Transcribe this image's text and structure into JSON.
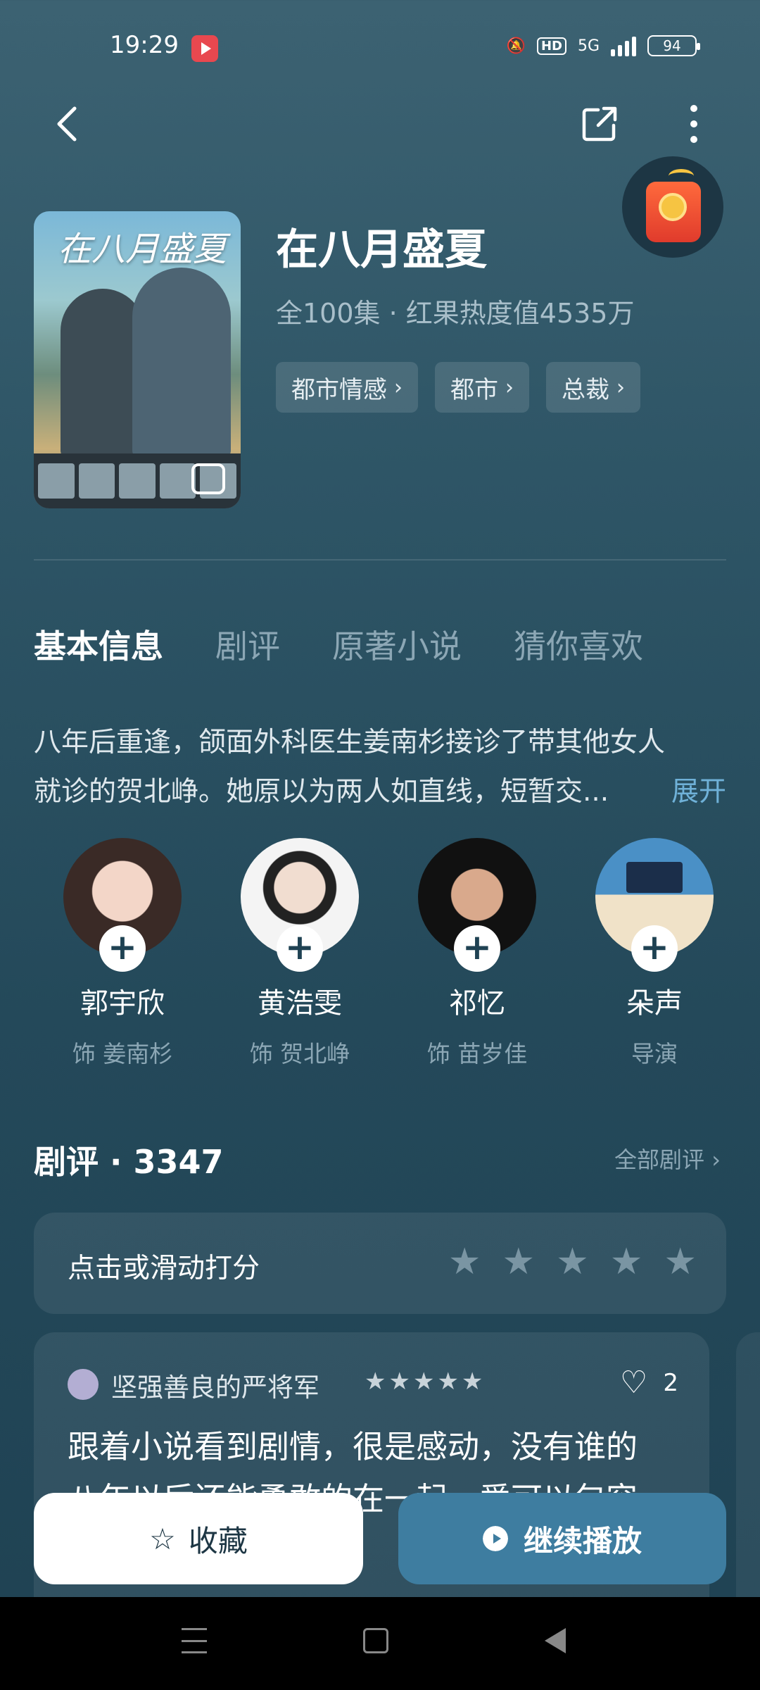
{
  "status_bar": {
    "time": "19:29",
    "network": "5G",
    "hd": "HD",
    "battery": "94"
  },
  "drama": {
    "title": "在八月盛夏",
    "poster_title": "在八月盛夏",
    "meta": "全100集 · 红果热度值4535万",
    "tags": [
      "都市情感",
      "都市",
      "总裁"
    ]
  },
  "tabs": [
    "基本信息",
    "剧评",
    "原著小说",
    "猜你喜欢"
  ],
  "synopsis": {
    "line1": "八年后重逢，颌面外科医生姜南杉接诊了带其他女人",
    "line2": "就诊的贺北峥。她原以为两人如直线，短暂交...",
    "expand": "展开"
  },
  "cast": [
    {
      "name": "郭宇欣",
      "role": "饰 姜南杉"
    },
    {
      "name": "黄浩雯",
      "role": "饰 贺北峥"
    },
    {
      "name": "祁忆",
      "role": "饰 苗岁佳"
    },
    {
      "name": "朵声",
      "role": "导演"
    }
  ],
  "reviews": {
    "title": "剧评 · 3347",
    "all_label": "全部剧评",
    "rate_prompt": "点击或滑动打分",
    "first": {
      "user": "坚强善良的严将军",
      "stars": 5,
      "likes": "2",
      "text_line1": "跟着小说看到剧情，很是感动，没有谁的",
      "text_line2": "八年以后还能勇敢的在一起，爱可以包容"
    }
  },
  "actions": {
    "collect": "收藏",
    "play": "继续播放"
  },
  "colors": {
    "accent": "#3e7da0",
    "link": "#6fb1d8",
    "background": "#2e5566"
  }
}
